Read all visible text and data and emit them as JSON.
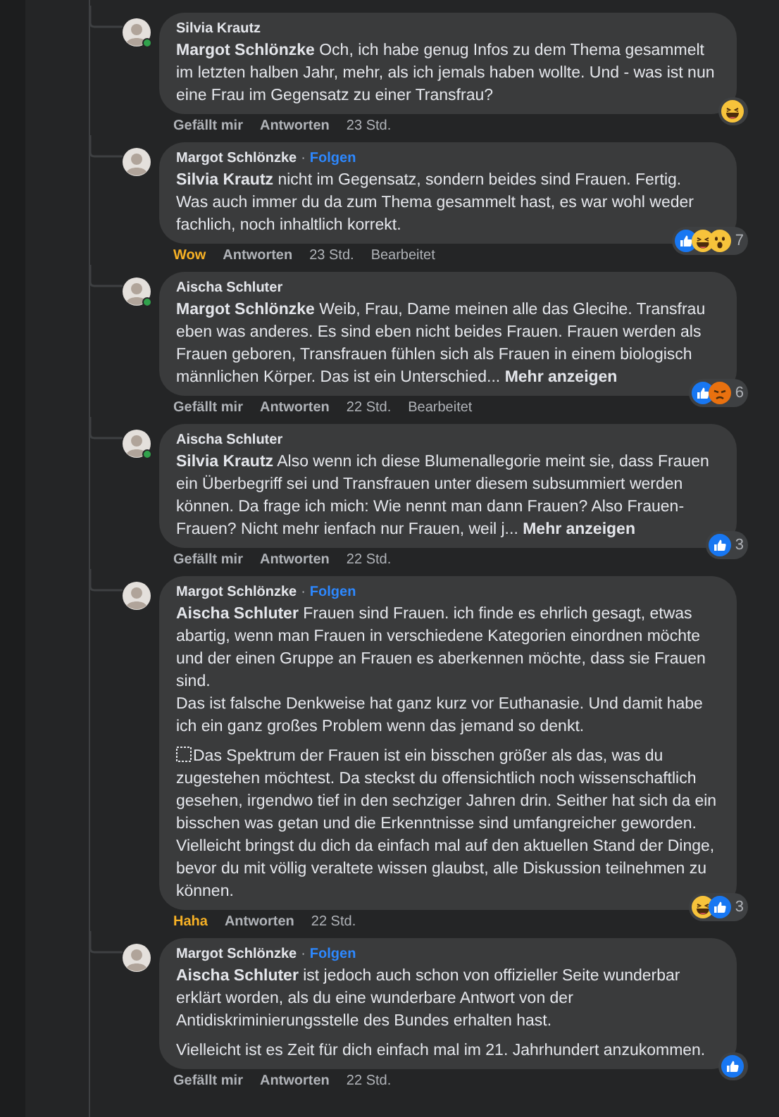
{
  "comments": [
    {
      "author": "Silvia Krautz",
      "online": true,
      "paragraphs": [
        {
          "text": "**Margot Schlönzke** Och, ich habe genug Infos zu dem Thema gesammelt im letzten halben Jahr, mehr, als ich jemals haben wollte. Und - was ist nun eine Frau im Gegensatz zu einer Transfrau?"
        }
      ],
      "reactions": [
        {
          "kind": "haha"
        }
      ],
      "reacted": false,
      "react_label": "Gefällt mir",
      "reply_label": "Antworten",
      "time": "23 Std."
    },
    {
      "author": "Margot Schlönzke",
      "online": false,
      "follow": {
        "dot": "·",
        "label": "Folgen"
      },
      "paragraphs": [
        {
          "text": "**Silvia Krautz** nicht im Gegensatz, sondern beides sind Frauen. Fertig.\nWas auch immer du da zum Thema gesammelt hast, es war wohl weder fachlich, noch inhaltlich korrekt."
        }
      ],
      "reactions": [
        {
          "kind": "like"
        },
        {
          "kind": "haha"
        },
        {
          "kind": "wow"
        }
      ],
      "count": "7",
      "reacted": true,
      "react_label": "Wow",
      "reply_label": "Antworten",
      "time": "23 Std.",
      "edited": "Bearbeitet"
    },
    {
      "author": "Aischa Schluter",
      "online": true,
      "paragraphs": [
        {
          "text": "**Margot Schlönzke** Weib, Frau, Dame meinen alle das Glecihe. Transfrau eben was anderes. Es sind eben nicht beides Frauen. Frauen werden als Frauen geboren, Transfrauen fühlen sich als Frauen in einem biologisch männlichen Körper. Das ist ein Unterschied..."
        }
      ],
      "more": "Mehr anzeigen",
      "reactions": [
        {
          "kind": "like"
        },
        {
          "kind": "angry"
        }
      ],
      "count": "6",
      "reacted": false,
      "react_label": "Gefällt mir",
      "reply_label": "Antworten",
      "time": "22 Std.",
      "edited": "Bearbeitet"
    },
    {
      "author": "Aischa Schluter",
      "online": true,
      "paragraphs": [
        {
          "text": "**Silvia Krautz** Also wenn ich diese Blumenallegorie meint sie, dass Frauen ein Überbegriff sei und Transfrauen unter diesem subsummiert werden können. Da frage ich mich: Wie nennt man dann Frauen? Also Frauen-Frauen? Nicht mehr ienfach nur Frauen, weil j..."
        }
      ],
      "more": "Mehr anzeigen",
      "reactions": [
        {
          "kind": "like"
        }
      ],
      "count": "3",
      "reacted": false,
      "react_label": "Gefällt mir",
      "reply_label": "Antworten",
      "time": "22 Std."
    },
    {
      "author": "Margot Schlönzke",
      "online": false,
      "follow": {
        "dot": "·",
        "label": "Folgen"
      },
      "paragraphs": [
        {
          "text": "**Aischa Schluter** Frauen sind Frauen. ich finde es ehrlich gesagt, etwas abartig, wenn man Frauen in verschiedene Kategorien einordnen möchte und der einen Gruppe an Frauen es aberkennen möchte, dass sie Frauen sind.\nDas ist falsche Denkweise hat ganz kurz vor Euthanasie. Und damit habe ich ein ganz großes Problem wenn das jemand so denkt."
        },
        {
          "object_mark": true,
          "text": "Das Spektrum der Frauen ist ein bisschen größer als das, was du zugestehen möchtest. Da steckst du offensichtlich noch wissenschaftlich gesehen, irgendwo tief in den sechziger Jahren drin. Seither hat sich da ein bisschen was getan und die Erkenntnisse sind umfangreicher geworden. Vielleicht bringst du dich da einfach mal auf den aktuellen Stand der Dinge, bevor du mit völlig veraltete wissen glaubst, alle Diskussion teilnehmen zu können."
        }
      ],
      "reactions": [
        {
          "kind": "haha"
        },
        {
          "kind": "like"
        }
      ],
      "count": "3",
      "reacted": true,
      "react_label": "Haha",
      "reply_label": "Antworten",
      "time": "22 Std."
    },
    {
      "author": "Margot Schlönzke",
      "online": false,
      "follow": {
        "dot": "·",
        "label": "Folgen"
      },
      "paragraphs": [
        {
          "text": "**Aischa Schluter** ist jedoch auch schon von offizieller Seite wunderbar erklärt worden, als du eine wunderbare Antwort von der Antidiskriminierungsstelle des Bundes erhalten hast."
        },
        {
          "text": "Vielleicht ist es Zeit für dich einfach mal im 21. Jahrhundert anzukommen."
        }
      ],
      "reactions": [
        {
          "kind": "like"
        }
      ],
      "reacted": false,
      "react_label": "Gefällt mir",
      "reply_label": "Antworten",
      "time": "22 Std."
    }
  ]
}
